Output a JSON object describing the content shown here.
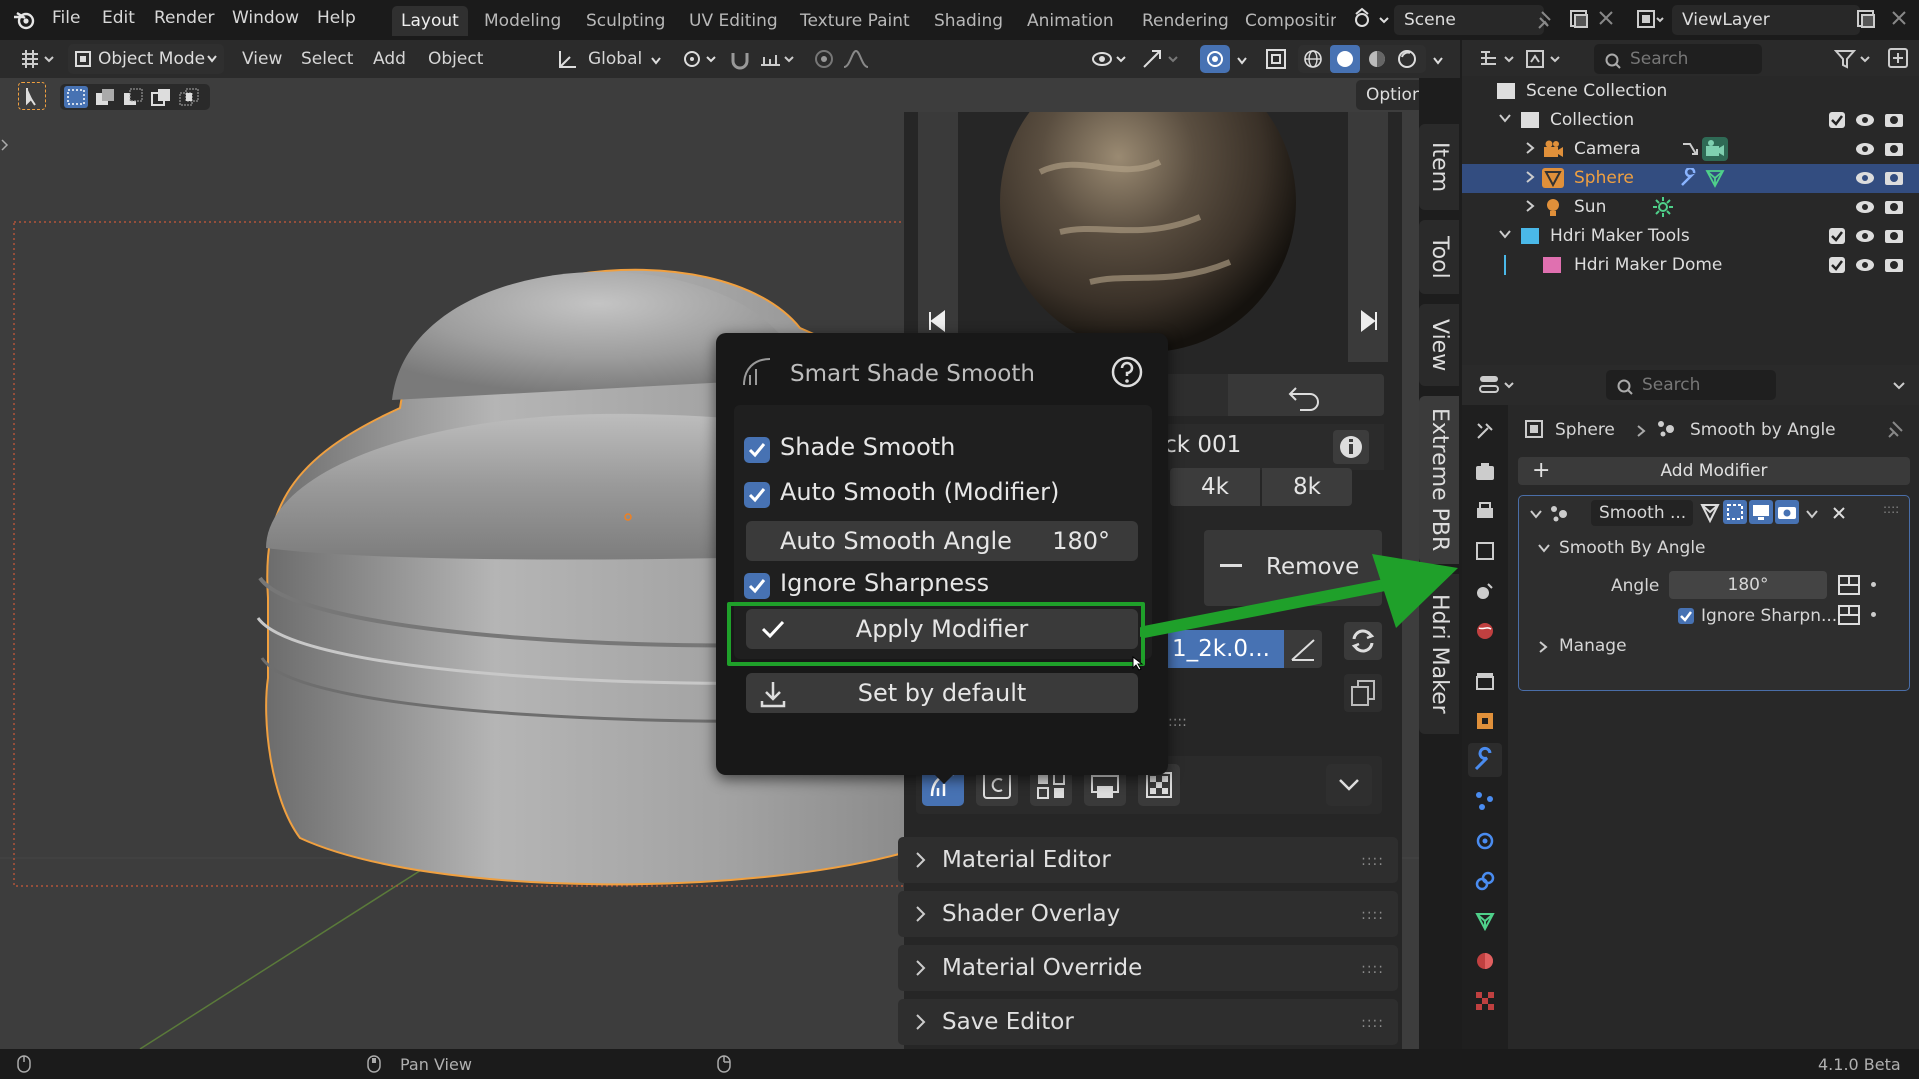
{
  "menubar": {
    "items": [
      "File",
      "Edit",
      "Render",
      "Window",
      "Help"
    ],
    "workspaces": [
      "Layout",
      "Modeling",
      "Sculpting",
      "UV Editing",
      "Texture Paint",
      "Shading",
      "Animation",
      "Rendering",
      "Compositin"
    ],
    "scene_label": "Scene",
    "viewlayer_label": "ViewLayer"
  },
  "header": {
    "mode": "Object Mode",
    "menus": [
      "View",
      "Select",
      "Add",
      "Object"
    ],
    "orientation": "Global",
    "options_label": "Options"
  },
  "npanel": {
    "tabs": [
      "Item",
      "Tool",
      "View",
      "Extreme PBR",
      "Hdri Maker"
    ],
    "material_name_partial": "ock 001",
    "resolutions": [
      "4k",
      "8k"
    ],
    "remove_label": "Remove",
    "file_field": "1_2k.0...",
    "sections": [
      "Material Editor",
      "Shader Overlay",
      "Material Override",
      "Save Editor"
    ]
  },
  "popup": {
    "title": "Smart Shade Smooth",
    "shade_smooth": {
      "label": "Shade Smooth",
      "checked": true
    },
    "auto_smooth": {
      "label": "Auto Smooth (Modifier)",
      "checked": true
    },
    "angle_label": "Auto Smooth Angle",
    "angle_value": "180°",
    "ignore_sharpness": {
      "label": "Ignore Sharpness",
      "checked": true
    },
    "apply_modifier": "Apply Modifier",
    "set_default": "Set by default"
  },
  "outliner": {
    "search_placeholder": "Search",
    "scene_collection": "Scene Collection",
    "rows": [
      {
        "label": "Collection"
      },
      {
        "label": "Camera"
      },
      {
        "label": "Sphere"
      },
      {
        "label": "Sun"
      },
      {
        "label": "Hdri Maker Tools"
      },
      {
        "label": "Hdri Maker Dome"
      }
    ]
  },
  "properties": {
    "search_placeholder": "Search",
    "breadcrumb_object": "Sphere",
    "breadcrumb_modifier": "Smooth by Angle",
    "add_modifier": "Add Modifier",
    "modifier_name": "Smooth ...",
    "panel_title": "Smooth By Angle",
    "angle_label": "Angle",
    "angle_value": "180°",
    "ignore_label": "Ignore Sharpn...",
    "manage_label": "Manage"
  },
  "statusbar": {
    "action": "Pan View",
    "version": "4.1.0 Beta"
  },
  "colors": {
    "accent": "#4772b3",
    "highlight_green": "#1fa02a",
    "selection_orange": "#f0a040"
  }
}
